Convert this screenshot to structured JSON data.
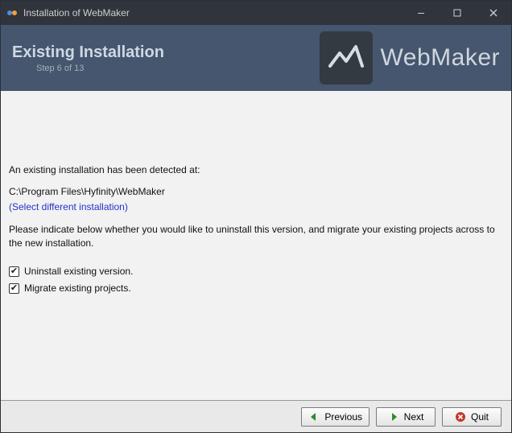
{
  "window": {
    "title": "Installation of WebMaker"
  },
  "header": {
    "title": "Existing Installation",
    "step_text": "Step 6 of 13",
    "brand": "WebMaker"
  },
  "content": {
    "detected_label": "An existing installation has been detected at:",
    "install_path": "C:\\Program Files\\Hyfinity\\WebMaker",
    "select_different": "(Select different installation)",
    "instruction": "Please indicate below whether you would like to uninstall this version, and migrate your existing projects across to the new installation.",
    "checkbox_uninstall": "Uninstall existing version.",
    "checkbox_migrate": "Migrate existing projects."
  },
  "footer": {
    "previous": "Previous",
    "next": "Next",
    "quit": "Quit"
  },
  "colors": {
    "titlebar": "#2f343d",
    "header": "#45566e",
    "link": "#2233cc"
  }
}
